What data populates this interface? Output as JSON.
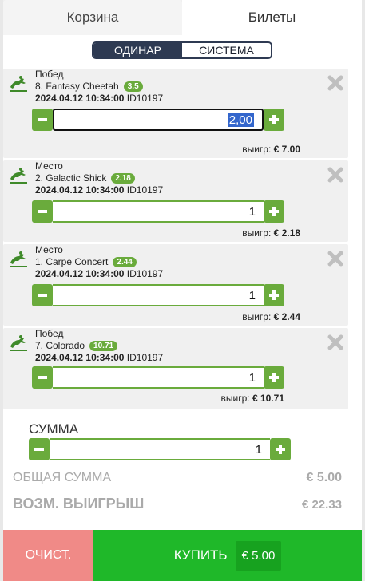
{
  "tabs": {
    "basket": "Корзина",
    "tickets": "Билеты"
  },
  "mode": {
    "single": "ОДИНАР",
    "system": "СИСТЕМА"
  },
  "bets": [
    {
      "type": "Побед",
      "runner": "8. Fantasy Cheetah",
      "odds": "3.5",
      "date": "2024.04.12 10:34:00",
      "event_id": "ID10197",
      "stake": "2,00",
      "win_label": "выигр:",
      "win_value": "€ 7.00"
    },
    {
      "type": "Место",
      "runner": "2. Galactic Shick",
      "odds": "2.18",
      "date": "2024.04.12 10:34:00",
      "event_id": "ID10197",
      "stake": "1",
      "win_label": "выигр:",
      "win_value": "€ 2.18"
    },
    {
      "type": "Место",
      "runner": "1. Carpe Concert",
      "odds": "2.44",
      "date": "2024.04.12 10:34:00",
      "event_id": "ID10197",
      "stake": "1",
      "win_label": "выигр:",
      "win_value": "€ 2.44"
    },
    {
      "type": "Побед",
      "runner": "7. Colorado",
      "odds": "10.71",
      "date": "2024.04.12 10:34:00",
      "event_id": "ID10197",
      "stake": "1",
      "win_label": "выигр:",
      "win_value": "€ 10.71"
    }
  ],
  "summary": {
    "label": "СУММА",
    "value": "1",
    "total_label": "ОБЩАЯ СУММА",
    "total_value": "€ 5.00",
    "potential_label": "ВОЗМ. ВЫИГРЫШ",
    "potential_value": "€ 22.33"
  },
  "actions": {
    "clear": "ОЧИСТ.",
    "buy": "КУПИТЬ",
    "buy_amount": "€ 5.00"
  },
  "colors": {
    "accent_green": "#6aab3c",
    "buy_green": "#1fb829",
    "clear_red": "#f08a87",
    "toggle_navy": "#2e3a52"
  },
  "icons": {
    "sport": "horse-jumping-icon",
    "remove": "close-x-icon",
    "minus": "minus-icon",
    "plus": "plus-icon"
  }
}
